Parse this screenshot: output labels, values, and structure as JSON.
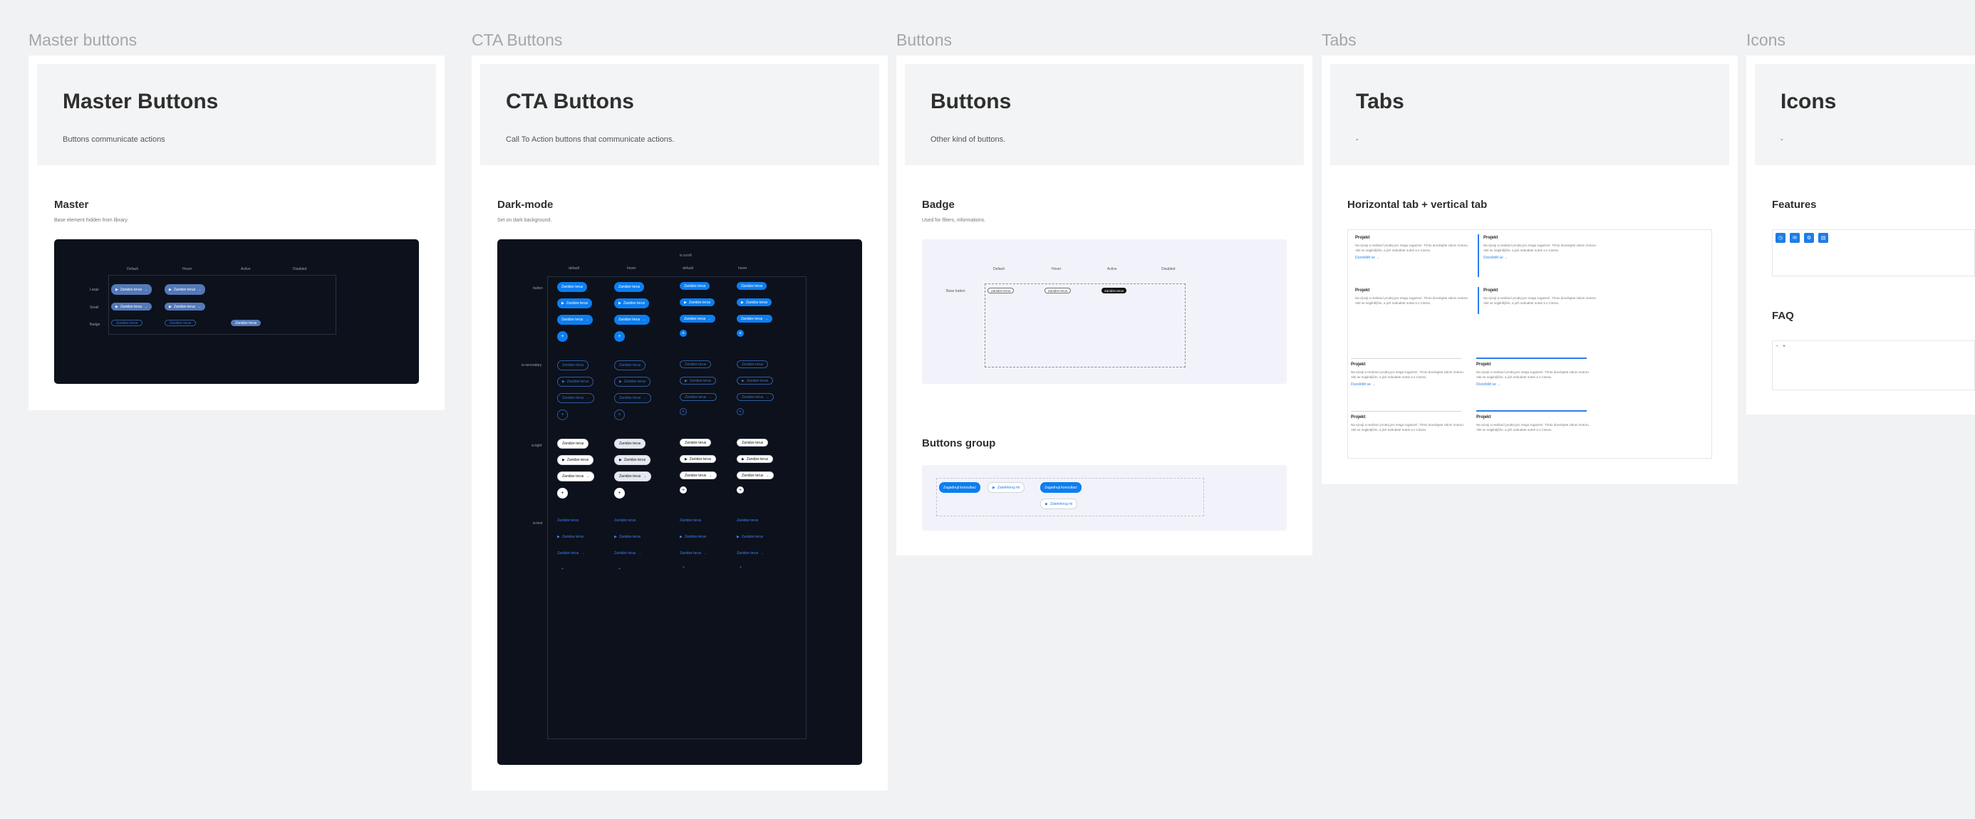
{
  "frames": {
    "master": {
      "label": "Master buttons",
      "title": "Master Buttons",
      "desc": "Buttons communicate actions",
      "section_title": "Master",
      "section_sub": "Base element hidden from library.",
      "cols": [
        "Default",
        "Hover",
        "Active",
        "Disabled"
      ],
      "rows": [
        "Large",
        "Small",
        "Badge"
      ],
      "button_label": "Zanidze terus"
    },
    "cta": {
      "label": "CTA Buttons",
      "title": "CTA Buttons",
      "desc": "Call To Action buttons that communicate actions.",
      "section_title": "Dark-mode",
      "section_sub": "Set on dark background.",
      "top_label": "is scroll",
      "cols": [
        "default",
        "hover",
        "default",
        "hover"
      ],
      "rows": [
        "button",
        "is-secondary",
        "is-light",
        "is-text"
      ],
      "button_label": "Zanidze terus"
    },
    "buttons": {
      "label": "Buttons",
      "title": "Buttons",
      "desc": "Other kind of buttons.",
      "badge_title": "Badge",
      "badge_sub": "Used for filters, informations.",
      "badge_cols": [
        "Default",
        "Hover",
        "Active",
        "Disabled"
      ],
      "badge_row": "Base button",
      "badge_label": "Zanidze terus",
      "group_title": "Buttons group",
      "group_btn_primary": "Zagadnuji konzultaci",
      "group_btn_secondary": "Zatelefonuj mi"
    },
    "tabs": {
      "label": "Tabs",
      "title": "Tabs",
      "desc": "-",
      "section_title": "Horizontal tab + vertical tab",
      "card_title": "Projekt",
      "card_desc": "Na vývoji a realizací prodej pro mega zugazení. Tímto dovolujete zalom motoru. Akti se nejplnějším, a jich nebudete nutné a s Cinera.",
      "card_link": "Dozvědět se"
    },
    "icons": {
      "label": "Icons",
      "title": "Icons",
      "desc": "-",
      "features_title": "Features",
      "faq_title": "FAQ"
    }
  }
}
